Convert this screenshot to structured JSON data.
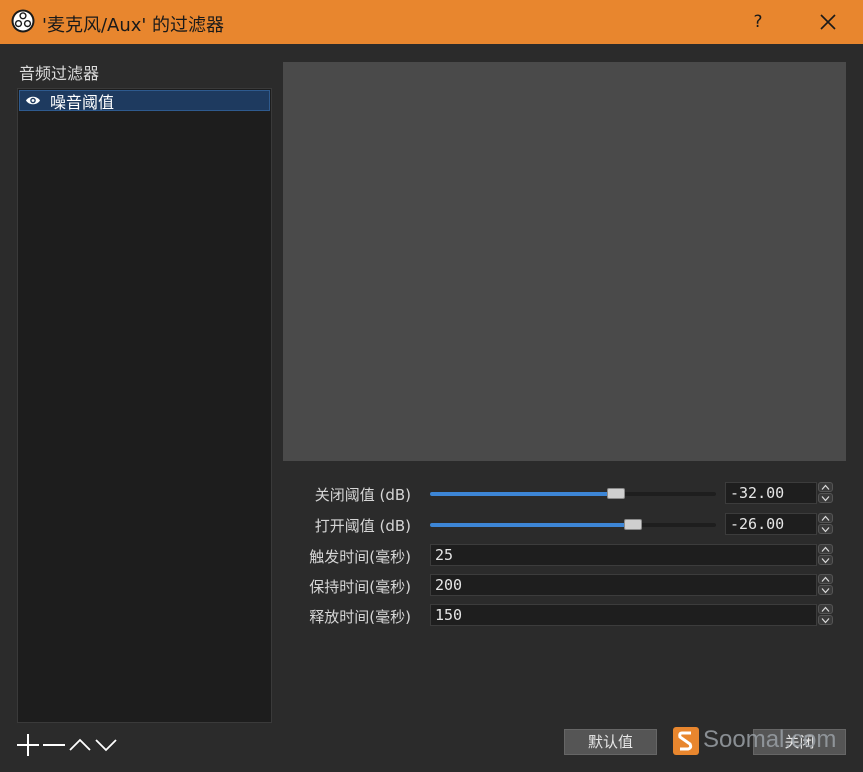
{
  "window": {
    "title": "'麦克风/Aux' 的过滤器",
    "help_label": "?",
    "icons": {
      "app": "obs-logo-icon",
      "close": "close-icon"
    }
  },
  "filters_panel": {
    "label": "音频过滤器",
    "items": [
      {
        "label": "噪音阈值",
        "visible": true,
        "icon": "eye-icon"
      }
    ],
    "tools": [
      "add-icon",
      "remove-icon",
      "move-up-icon",
      "move-down-icon"
    ]
  },
  "properties": {
    "close_threshold": {
      "label": "关闭阈值 (dB)",
      "value": "-32.00",
      "slider_fraction": 0.65
    },
    "open_threshold": {
      "label": "打开阈值 (dB)",
      "value": "-26.00",
      "slider_fraction": 0.71
    },
    "attack_time": {
      "label": "触发时间(毫秒)",
      "value": "25"
    },
    "hold_time": {
      "label": "保持时间(毫秒)",
      "value": "200"
    },
    "release_time": {
      "label": "释放时间(毫秒)",
      "value": "150"
    }
  },
  "footer": {
    "defaults_label": "默认值",
    "close_label": "关闭",
    "watermark_text": "Soomal.com"
  },
  "colors": {
    "titlebar": "#e8862e",
    "background": "#2b2b2b",
    "accent": "#3d86d6",
    "selection": "#1e3a5f"
  }
}
